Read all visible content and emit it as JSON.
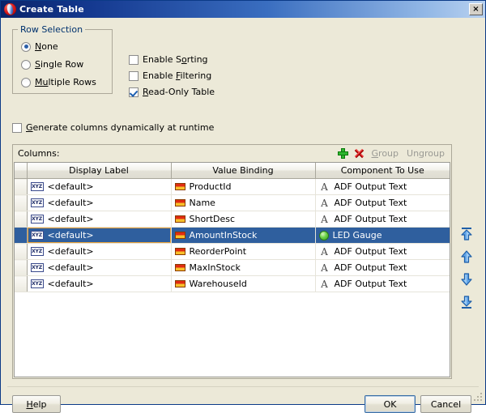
{
  "window": {
    "title": "Create Table",
    "icon": "jdeveloper-icon",
    "close_label": "×"
  },
  "row_selection": {
    "legend": "Row Selection",
    "options": [
      {
        "label": "None",
        "mnemonic": "N",
        "selected": true
      },
      {
        "label": "Single Row",
        "mnemonic": "S",
        "selected": false
      },
      {
        "label": "Multiple Rows",
        "mnemonic": "Mu",
        "selected": false
      }
    ]
  },
  "options": {
    "checkboxes": [
      {
        "label": "Enable Sorting",
        "mnemonic": "o",
        "checked": false
      },
      {
        "label": "Enable Filtering",
        "mnemonic": "F",
        "checked": false
      },
      {
        "label": "Read-Only Table",
        "mnemonic": "R",
        "checked": true
      }
    ],
    "generate_dynamic": {
      "label": "Generate columns dynamically at runtime",
      "mnemonic": "G",
      "checked": false
    }
  },
  "columns_panel": {
    "label": "Columns:",
    "toolbar": {
      "add_icon": "plus-icon",
      "delete_icon": "delete-x-icon",
      "group_label": "Group",
      "ungroup_label": "Ungroup",
      "group_enabled": false,
      "ungroup_enabled": false
    },
    "headers": [
      "Display Label",
      "Value Binding",
      "Component To Use"
    ],
    "rows": [
      {
        "display_label": "<default>",
        "value_binding": "ProductId",
        "component": "ADF Output Text",
        "component_icon": "adf-output-text-icon",
        "selected": false
      },
      {
        "display_label": "<default>",
        "value_binding": "Name",
        "component": "ADF Output Text",
        "component_icon": "adf-output-text-icon",
        "selected": false
      },
      {
        "display_label": "<default>",
        "value_binding": "ShortDesc",
        "component": "ADF Output Text",
        "component_icon": "adf-output-text-icon",
        "selected": false
      },
      {
        "display_label": "<default>",
        "value_binding": "AmountInStock",
        "component": "LED Gauge",
        "component_icon": "led-gauge-icon",
        "selected": true
      },
      {
        "display_label": "<default>",
        "value_binding": "ReorderPoint",
        "component": "ADF Output Text",
        "component_icon": "adf-output-text-icon",
        "selected": false
      },
      {
        "display_label": "<default>",
        "value_binding": "MaxInStock",
        "component": "ADF Output Text",
        "component_icon": "adf-output-text-icon",
        "selected": false
      },
      {
        "display_label": "<default>",
        "value_binding": "WarehouseId",
        "component": "ADF Output Text",
        "component_icon": "adf-output-text-icon",
        "selected": false
      }
    ]
  },
  "move_buttons": [
    {
      "name": "move-to-top-button",
      "icon": "arrow-up-to-line-icon"
    },
    {
      "name": "move-up-button",
      "icon": "arrow-up-icon"
    },
    {
      "name": "move-down-button",
      "icon": "arrow-down-icon"
    },
    {
      "name": "move-to-bottom-button",
      "icon": "arrow-down-to-line-icon"
    }
  ],
  "footer": {
    "help_label": "Help",
    "help_mnemonic": "H",
    "ok_label": "OK",
    "cancel_label": "Cancel"
  },
  "colors": {
    "title_start": "#0a246a",
    "title_end": "#b8d1f0",
    "dialog_bg": "#ece9d8",
    "selection": "#2f5f9e",
    "focus_outline": "#e8a13a",
    "legend_text": "#00326e",
    "disabled_text": "#9a9a94",
    "add_green": "#2fb62f",
    "delete_red": "#d81818",
    "led_green": "#6fd44a"
  }
}
